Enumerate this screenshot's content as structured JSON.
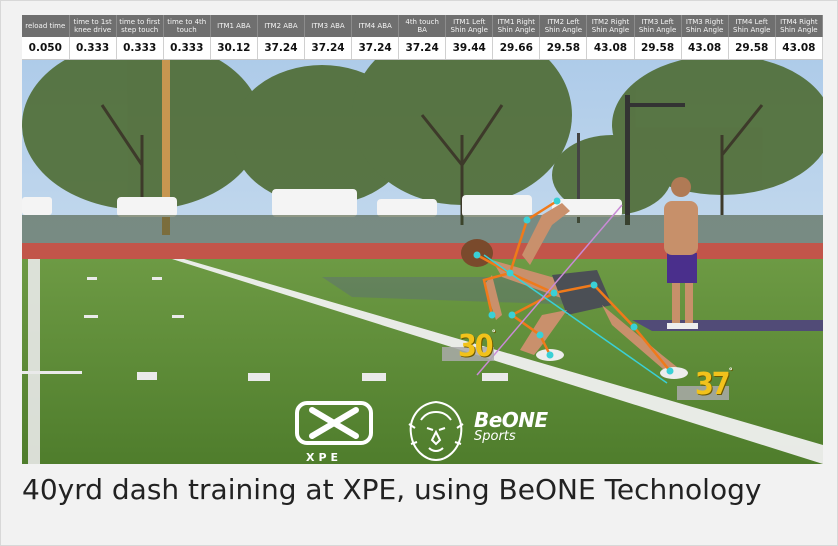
{
  "metrics": {
    "headers": [
      "reload time",
      "time to 1st knee drive",
      "time to first step touch",
      "time to 4th touch",
      "ITM1 ABA",
      "ITM2 ABA",
      "ITM3 ABA",
      "ITM4 ABA",
      "4th touch BA",
      "ITM1 Left Shin Angle",
      "ITM1 Right Shin Angle",
      "ITM2 Left Shin Angle",
      "ITM2 Right Shin Angle",
      "ITM3 Left Shin Angle",
      "ITM3 Right Shin Angle",
      "ITM4 Left Shin Angle",
      "ITM4 Right Shin Angle"
    ],
    "values": [
      "0.050",
      "0.333",
      "0.333",
      "0.333",
      "30.12",
      "37.24",
      "37.24",
      "37.24",
      "37.24",
      "39.44",
      "29.66",
      "29.58",
      "43.08",
      "29.58",
      "43.08",
      "29.58",
      "43.08"
    ]
  },
  "overlay": {
    "angle_left": "30",
    "angle_right": "37",
    "degree_symbol": "°"
  },
  "logos": {
    "xpe_text": "XPE",
    "beone_line1": "BeONE",
    "beone_line2": "Sports"
  },
  "colors": {
    "angle_yellow": "#f2c21b",
    "skeleton_orange": "#f07a1a",
    "skeleton_cyan": "#3ad0d6"
  },
  "caption": "40yrd dash training at XPE, using BeONE Technology"
}
